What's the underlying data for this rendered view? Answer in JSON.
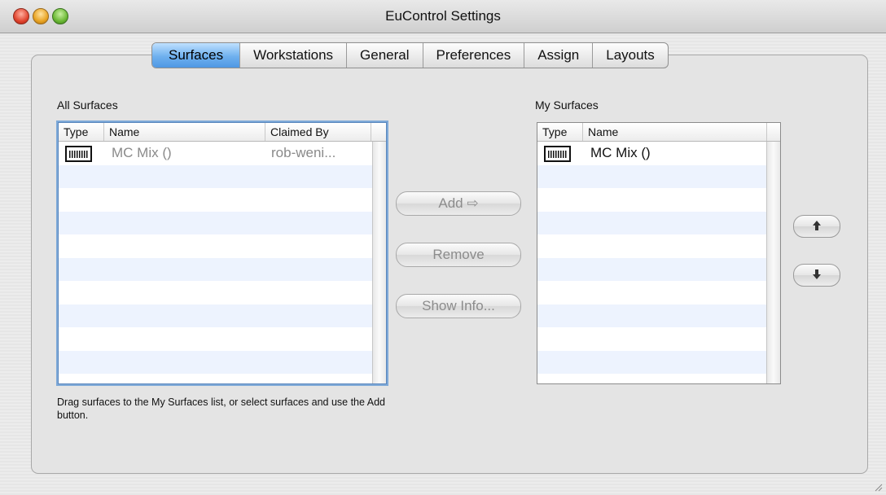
{
  "window": {
    "title": "EuControl Settings"
  },
  "tabs": [
    {
      "label": "Surfaces",
      "active": true
    },
    {
      "label": "Workstations",
      "active": false
    },
    {
      "label": "General",
      "active": false
    },
    {
      "label": "Preferences",
      "active": false
    },
    {
      "label": "Assign",
      "active": false
    },
    {
      "label": "Layouts",
      "active": false
    }
  ],
  "all_surfaces": {
    "label": "All Surfaces",
    "columns": [
      "Type",
      "Name",
      "Claimed By"
    ],
    "rows": [
      {
        "type_icon": "surface-icon",
        "name": "MC Mix ()",
        "claimed_by": "rob-weni..."
      }
    ]
  },
  "my_surfaces": {
    "label": "My Surfaces",
    "columns": [
      "Type",
      "Name"
    ],
    "rows": [
      {
        "type_icon": "surface-icon",
        "name": "MC Mix ()"
      }
    ]
  },
  "actions": {
    "add_label": "Add ⇨",
    "remove_label": "Remove",
    "show_info_label": "Show Info..."
  },
  "reorder": {
    "up_icon": "arrow-up-icon",
    "down_icon": "arrow-down-icon"
  },
  "hint_text": "Drag surfaces to the My Surfaces list, or select surfaces and use the Add button."
}
